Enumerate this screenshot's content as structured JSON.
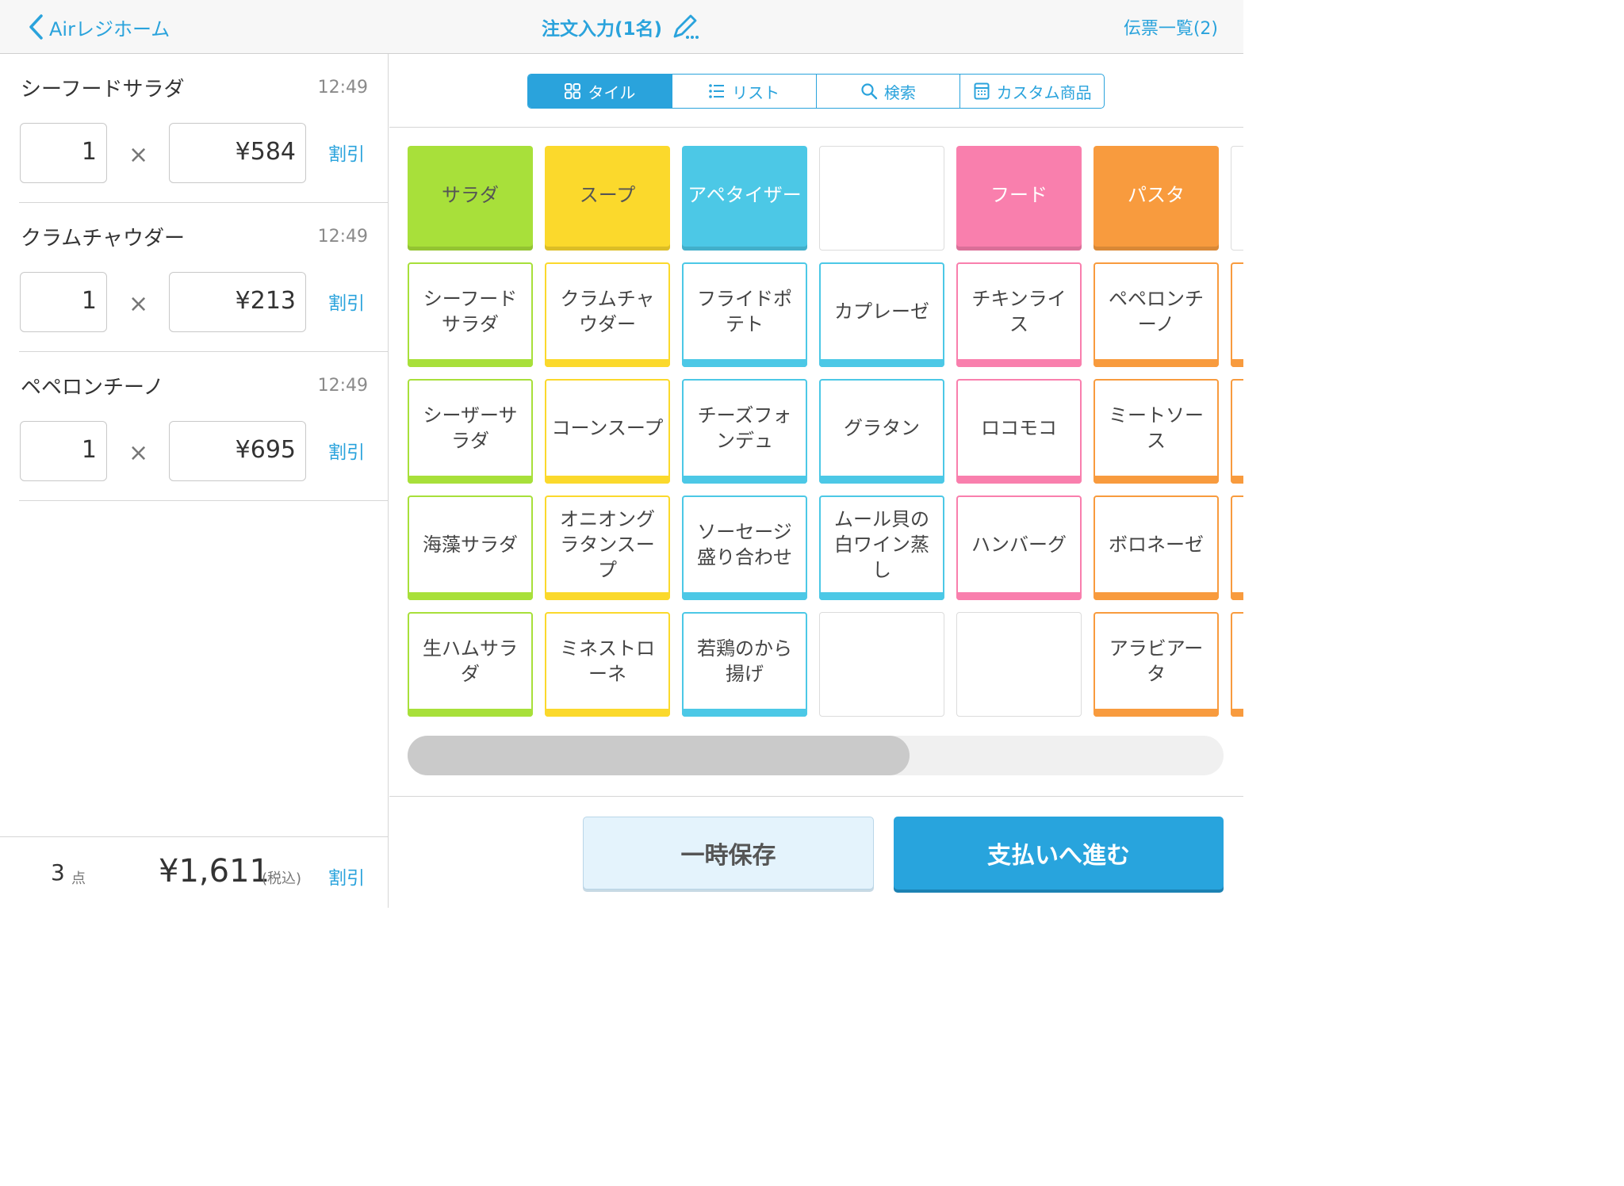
{
  "header": {
    "back_label": "Airレジホーム",
    "title": "注文入力(1名)",
    "voucher_link": "伝票一覧(2)"
  },
  "order_items": [
    {
      "name": "シーフードサラダ",
      "time": "12:49",
      "qty": "1",
      "price": "¥584",
      "discount": "割引"
    },
    {
      "name": "クラムチャウダー",
      "time": "12:49",
      "qty": "1",
      "price": "¥213",
      "discount": "割引"
    },
    {
      "name": "ペペロンチーノ",
      "time": "12:49",
      "qty": "1",
      "price": "¥695",
      "discount": "割引"
    }
  ],
  "multiply_symbol": "×",
  "summary": {
    "count": "3",
    "count_unit": "点",
    "total": "¥1,611",
    "tax_note": "(税込)",
    "discount": "割引"
  },
  "view_tabs": [
    {
      "label": "タイル",
      "icon": "grid-icon",
      "active": true
    },
    {
      "label": "リスト",
      "icon": "list-icon",
      "active": false
    },
    {
      "label": "検索",
      "icon": "search-icon",
      "active": false
    },
    {
      "label": "カスタム商品",
      "icon": "calculator-icon",
      "active": false
    }
  ],
  "colors": {
    "accent": "#2aa3dc",
    "salad": "#a8e03a",
    "soup": "#fbd92c",
    "appetizer": "#4cc8e6",
    "food": "#f97fad",
    "pasta": "#f89b3e"
  },
  "categories": [
    {
      "label": "サラダ",
      "color": "salad"
    },
    {
      "label": "スープ",
      "color": "soup"
    },
    {
      "label": "アペタイザー",
      "color": "appetizer"
    },
    {
      "label": "",
      "color": "empty"
    },
    {
      "label": "フード",
      "color": "food"
    },
    {
      "label": "パスタ",
      "color": "pasta"
    }
  ],
  "product_rows": [
    [
      "シーフードサラダ",
      "クラムチャウダー",
      "フライドポテト",
      "カプレーゼ",
      "チキンライス",
      "ペペロンチーノ"
    ],
    [
      "シーザーサラダ",
      "コーンスープ",
      "チーズフォンデュ",
      "グラタン",
      "ロコモコ",
      "ミートソース"
    ],
    [
      "海藻サラダ",
      "オニオングラタンスープ",
      "ソーセージ盛り合わせ",
      "ムール貝の白ワイン蒸し",
      "ハンバーグ",
      "ボロネーゼ"
    ],
    [
      "生ハムサラダ",
      "ミネストローネ",
      "若鶏のから揚げ",
      "",
      "",
      "アラビアータ"
    ]
  ],
  "column_colors": [
    "salad",
    "soup",
    "appetizer",
    "appetizer",
    "food",
    "pasta"
  ],
  "scroll_position": 0.615,
  "actions": {
    "hold": "一時保存",
    "pay": "支払いへ進む"
  }
}
